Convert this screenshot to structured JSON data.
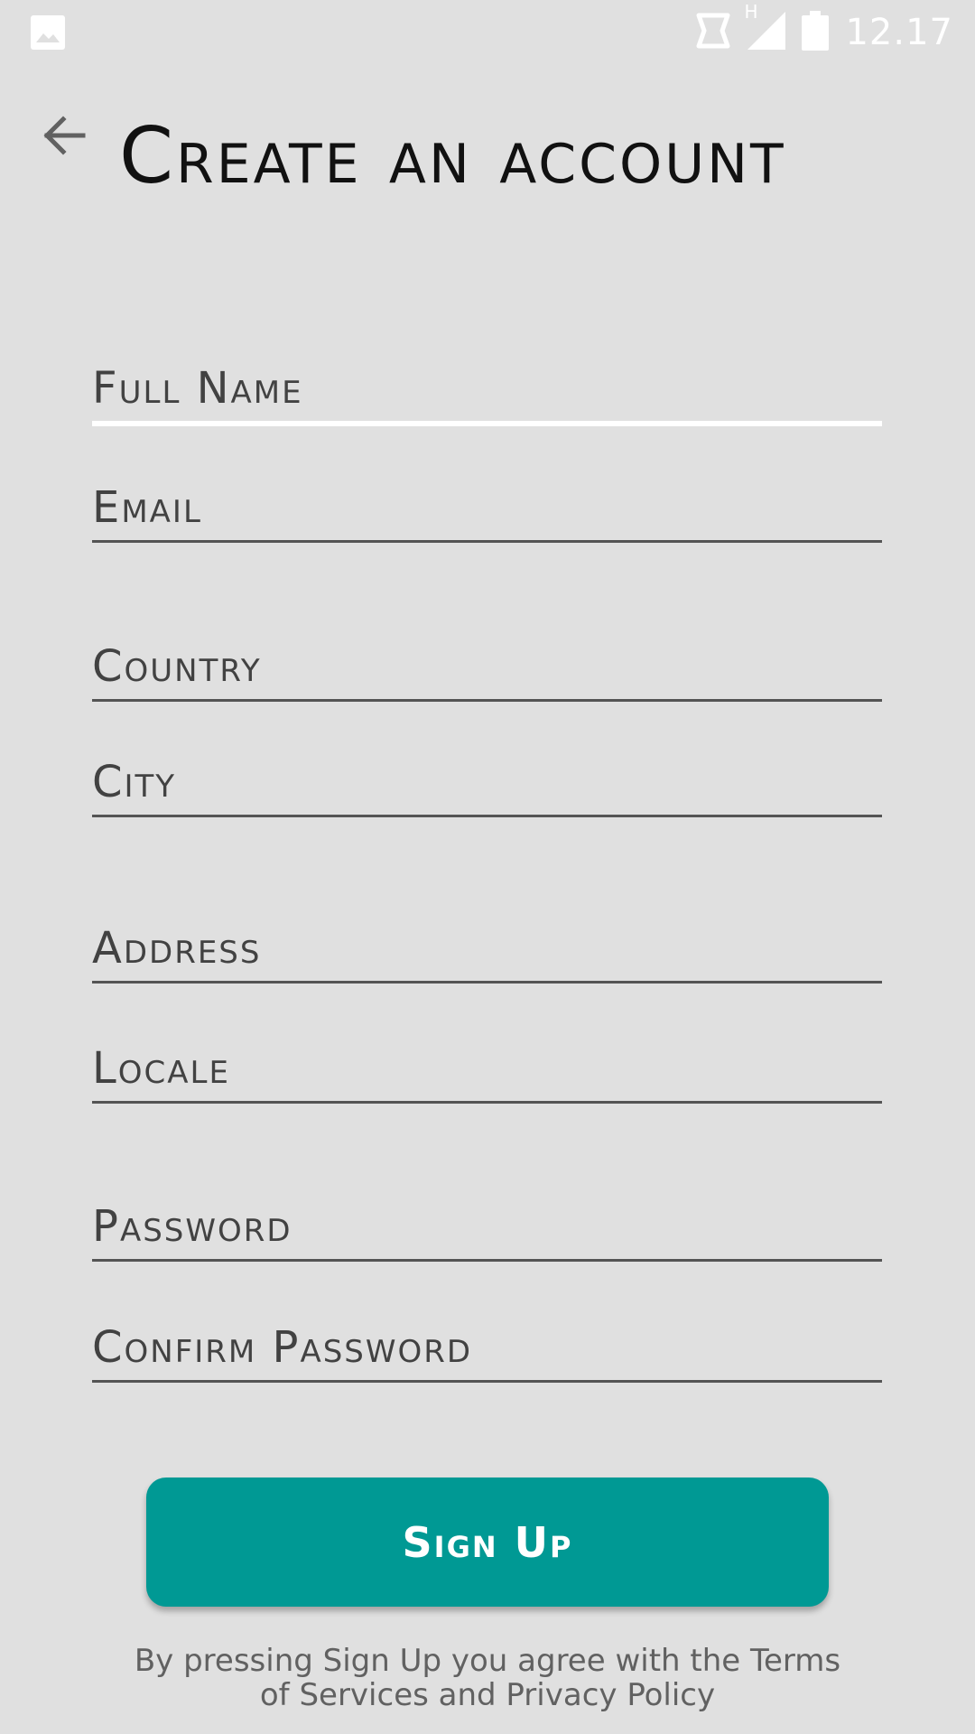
{
  "status_bar": {
    "left_icon": "image-icon",
    "icons": [
      "sync-icon",
      "signal-icon",
      "battery-icon"
    ],
    "network_label": "H",
    "time": "12.17"
  },
  "header": {
    "back_icon": "arrow-left-icon",
    "title": "Create an account"
  },
  "form": {
    "full_name": {
      "placeholder": "Full Name",
      "value": ""
    },
    "email": {
      "placeholder": "Email",
      "value": ""
    },
    "country": {
      "placeholder": "Country",
      "value": ""
    },
    "city": {
      "placeholder": "City",
      "value": ""
    },
    "address": {
      "placeholder": "Address",
      "value": ""
    },
    "locale": {
      "placeholder": "Locale",
      "value": ""
    },
    "password": {
      "placeholder": "Password",
      "value": ""
    },
    "confirm_password": {
      "placeholder": "Confirm Password",
      "value": ""
    }
  },
  "signup_button": {
    "label": "Sign Up"
  },
  "terms_text": "By pressing Sign Up you agree with the Terms of Services and Privacy Policy",
  "colors": {
    "background": "#e0e0e0",
    "accent": "#009994",
    "text": "#424242",
    "title": "#111111"
  }
}
